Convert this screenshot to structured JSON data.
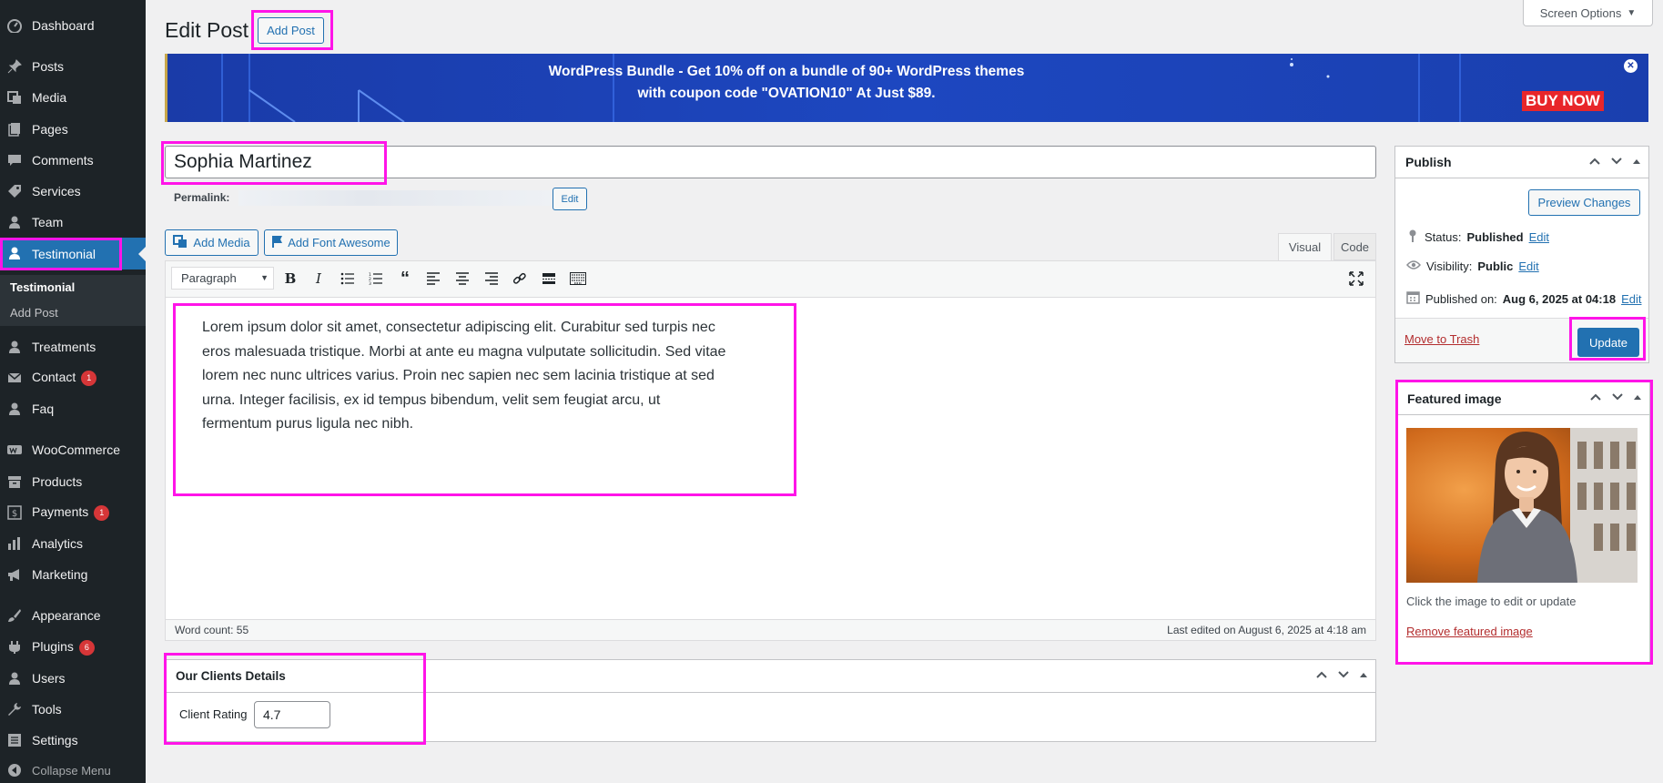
{
  "sidebar": {
    "items": [
      {
        "label": "Dashboard"
      },
      {
        "label": "Posts"
      },
      {
        "label": "Media"
      },
      {
        "label": "Pages"
      },
      {
        "label": "Comments"
      },
      {
        "label": "Services"
      },
      {
        "label": "Team"
      },
      {
        "label": "Testimonial"
      },
      {
        "label": "Treatments"
      },
      {
        "label": "Contact",
        "badge": "1"
      },
      {
        "label": "Faq"
      },
      {
        "label": "WooCommerce"
      },
      {
        "label": "Products"
      },
      {
        "label": "Payments",
        "badge": "1"
      },
      {
        "label": "Analytics"
      },
      {
        "label": "Marketing"
      },
      {
        "label": "Appearance"
      },
      {
        "label": "Plugins",
        "badge": "6"
      },
      {
        "label": "Users"
      },
      {
        "label": "Tools"
      },
      {
        "label": "Settings"
      },
      {
        "label": "Collapse Menu"
      }
    ],
    "submenu": [
      "Testimonial",
      "Add Post"
    ]
  },
  "header": {
    "title": "Edit Post",
    "add_post": "Add Post",
    "screen_options": "Screen Options"
  },
  "banner": {
    "line1": "WordPress Bundle - Get 10% off on a bundle of 90+ WordPress themes",
    "line2": "with coupon code \"OVATION10\" At Just $89.",
    "cta": "BUY NOW",
    "close": "✕"
  },
  "post": {
    "title_value": "Sophia Martinez",
    "permalink_label": "Permalink:",
    "permalink_edit": "Edit"
  },
  "editor": {
    "add_media": "Add Media",
    "add_font_awesome": "Add Font Awesome",
    "tab_visual": "Visual",
    "tab_code": "Code",
    "format_select": "Paragraph",
    "content": "Lorem ipsum dolor sit amet, consectetur adipiscing elit. Curabitur sed turpis nec eros malesuada tristique. Morbi at ante eu magna vulputate sollicitudin. Sed vitae lorem nec nunc ultrices varius. Proin nec sapien nec sem lacinia tristique at sed urna. Integer facilisis, ex id tempus bibendum, velit sem feugiat arcu, ut fermentum purus ligula nec nibh.",
    "word_count": "Word count: 55",
    "last_edited": "Last edited on August 6, 2025 at 4:18 am"
  },
  "clients": {
    "title": "Our Clients Details",
    "rating_label": "Client Rating",
    "rating_value": "4.7"
  },
  "publish": {
    "title": "Publish",
    "preview": "Preview Changes",
    "status_label": "Status:",
    "status_value": "Published",
    "visibility_label": "Visibility:",
    "visibility_value": "Public",
    "published_label": "Published on:",
    "published_value": "Aug 6, 2025 at 04:18",
    "edit": "Edit",
    "trash": "Move to Trash",
    "update": "Update"
  },
  "featured": {
    "title": "Featured image",
    "hint": "Click the image to edit or update",
    "remove": "Remove featured image"
  },
  "colors": {
    "accent": "#2271b1",
    "sidebar": "#1d2327",
    "highlight": "#ff14e8",
    "danger": "#d63638"
  }
}
